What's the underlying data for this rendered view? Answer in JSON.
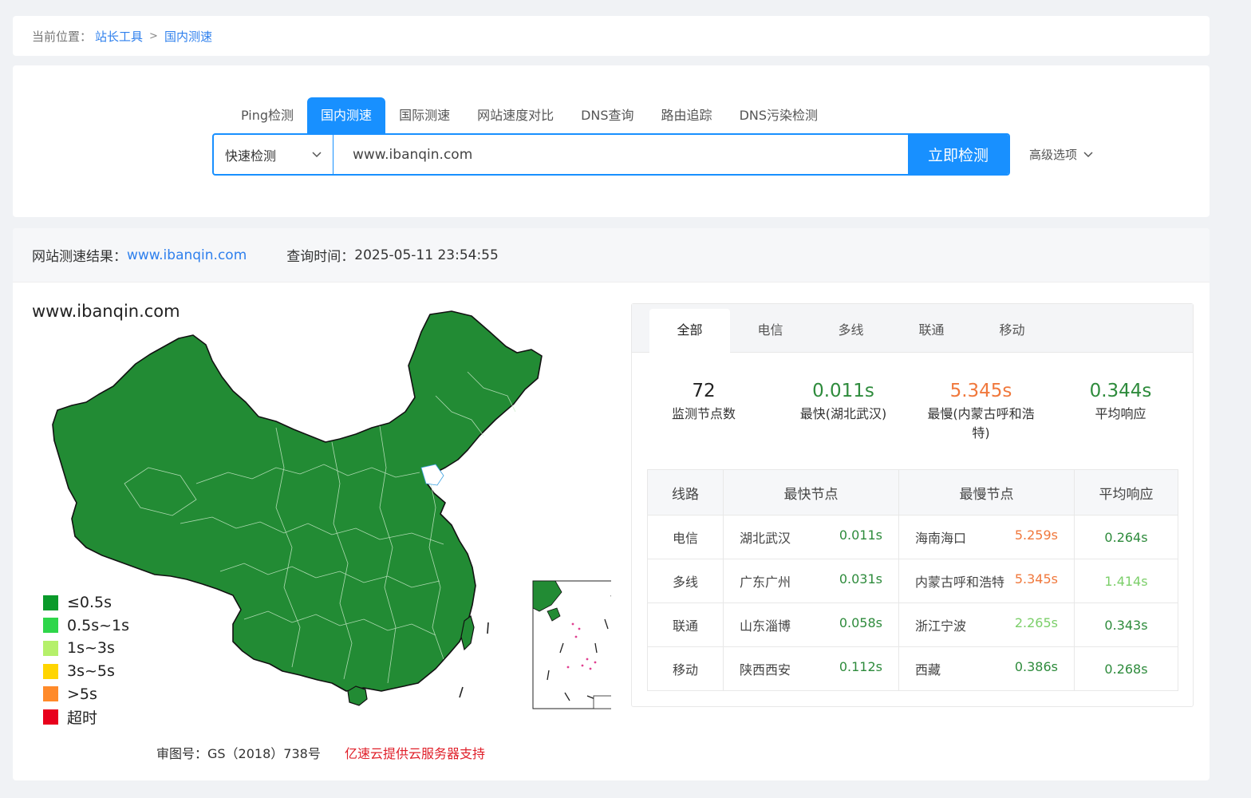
{
  "breadcrumb": {
    "label": "当前位置：",
    "items": [
      "站长工具",
      "国内测速"
    ],
    "separator": ">"
  },
  "tabs": [
    "Ping检测",
    "国内测速",
    "国际测速",
    "网站速度对比",
    "DNS查询",
    "路由追踪",
    "DNS污染检测"
  ],
  "active_tab": "国内测速",
  "search": {
    "mode": "快速检测",
    "value": "www.ibanqin.com",
    "button": "立即检测",
    "advanced": "高级选项"
  },
  "result": {
    "label": "网站测速结果：",
    "site": "www.ibanqin.com",
    "time_label": "查询时间：",
    "time": "2025-05-11 23:54:55"
  },
  "map": {
    "title": "www.ibanqin.com",
    "legend": [
      {
        "label": "≤0.5s",
        "color": "#0a9a2a"
      },
      {
        "label": "0.5s~1s",
        "color": "#2ed64a"
      },
      {
        "label": "1s~3s",
        "color": "#b5f06a"
      },
      {
        "label": "3s~5s",
        "color": "#ffd500"
      },
      {
        "label": ">5s",
        "color": "#ff8a2a"
      },
      {
        "label": "超时",
        "color": "#e8001c"
      }
    ],
    "fill_color": "#228b34",
    "approval": "审图号：GS（2018）738号",
    "sponsor": "亿速云提供云服务器支持"
  },
  "panel": {
    "tabs": [
      "全部",
      "电信",
      "多线",
      "联通",
      "移动"
    ],
    "active_tab": "全部",
    "stats": [
      {
        "value": "72",
        "label": "监测节点数",
        "color": "#222222"
      },
      {
        "value": "0.011s",
        "label": "最快(湖北武汉)",
        "color": "#2e8b3c"
      },
      {
        "value": "5.345s",
        "label": "最慢(内蒙古呼和浩特)",
        "color": "#f0783c"
      },
      {
        "value": "0.344s",
        "label": "平均响应",
        "color": "#2e8b3c"
      }
    ],
    "headers": [
      "线路",
      "最快节点",
      "最慢节点",
      "平均响应"
    ],
    "rows": [
      {
        "line": "电信",
        "fast_node": "湖北武汉",
        "fast_time": "0.011s",
        "slow_node": "海南海口",
        "slow_time": "5.259s",
        "avg": "0.264s",
        "slow_color": "#f0783c",
        "avg_color": "#2e8b3c"
      },
      {
        "line": "多线",
        "fast_node": "广东广州",
        "fast_time": "0.031s",
        "slow_node": "内蒙古呼和浩特",
        "slow_time": "5.345s",
        "avg": "1.414s",
        "slow_color": "#f0783c",
        "avg_color": "#7ccf6a"
      },
      {
        "line": "联通",
        "fast_node": "山东淄博",
        "fast_time": "0.058s",
        "slow_node": "浙江宁波",
        "slow_time": "2.265s",
        "avg": "0.343s",
        "slow_color": "#7ccf6a",
        "avg_color": "#2e8b3c"
      },
      {
        "line": "移动",
        "fast_node": "陕西西安",
        "fast_time": "0.112s",
        "slow_node": "西藏",
        "slow_time": "0.386s",
        "avg": "0.268s",
        "slow_color": "#2e8b3c",
        "avg_color": "#2e8b3c"
      }
    ]
  }
}
